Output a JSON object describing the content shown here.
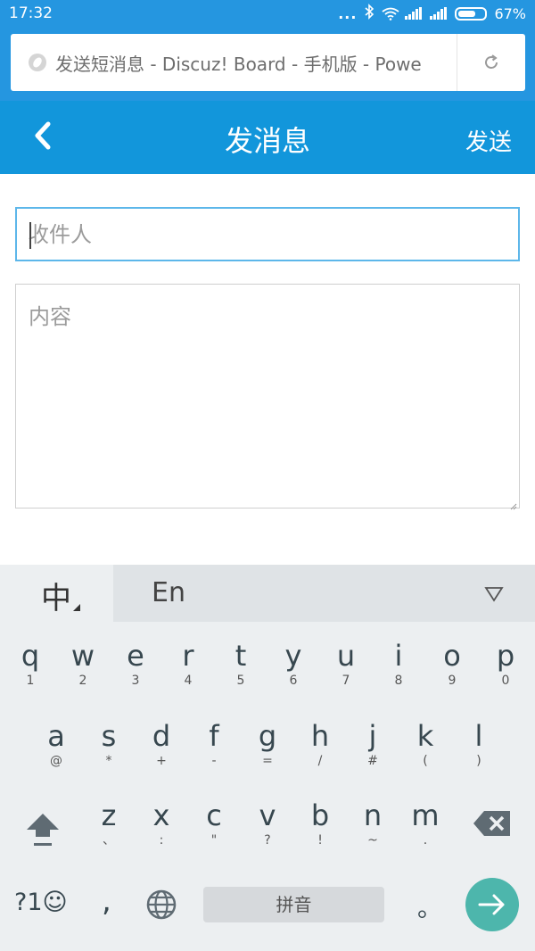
{
  "status_bar": {
    "time": "17:32",
    "dots": "...",
    "battery_percent": "67%",
    "battery_level": 0.67
  },
  "browser": {
    "url_title": "发送短消息 - Discuz! Board - 手机版 - Powe"
  },
  "header": {
    "title": "发消息",
    "send_label": "发送"
  },
  "form": {
    "recipient_placeholder": "收件人",
    "content_placeholder": "内容"
  },
  "keyboard": {
    "lang_zh": "中",
    "lang_en": "En",
    "row1": [
      {
        "k": "q",
        "s": "1"
      },
      {
        "k": "w",
        "s": "2"
      },
      {
        "k": "e",
        "s": "3"
      },
      {
        "k": "r",
        "s": "4"
      },
      {
        "k": "t",
        "s": "5"
      },
      {
        "k": "y",
        "s": "6"
      },
      {
        "k": "u",
        "s": "7"
      },
      {
        "k": "i",
        "s": "8"
      },
      {
        "k": "o",
        "s": "9"
      },
      {
        "k": "p",
        "s": "0"
      }
    ],
    "row2": [
      {
        "k": "a",
        "s": "@"
      },
      {
        "k": "s",
        "s": "*"
      },
      {
        "k": "d",
        "s": "+"
      },
      {
        "k": "f",
        "s": "-"
      },
      {
        "k": "g",
        "s": "="
      },
      {
        "k": "h",
        "s": "/"
      },
      {
        "k": "j",
        "s": "#"
      },
      {
        "k": "k",
        "s": "("
      },
      {
        "k": "l",
        "s": ")"
      }
    ],
    "row3": [
      {
        "k": "z",
        "s": "、"
      },
      {
        "k": "x",
        "s": ":"
      },
      {
        "k": "c",
        "s": "\""
      },
      {
        "k": "v",
        "s": "?"
      },
      {
        "k": "b",
        "s": "!"
      },
      {
        "k": "n",
        "s": "~"
      },
      {
        "k": "m",
        "s": "."
      }
    ],
    "symbols_label": "?1☺",
    "comma": ",",
    "space_label": "拼音",
    "period": "。"
  }
}
